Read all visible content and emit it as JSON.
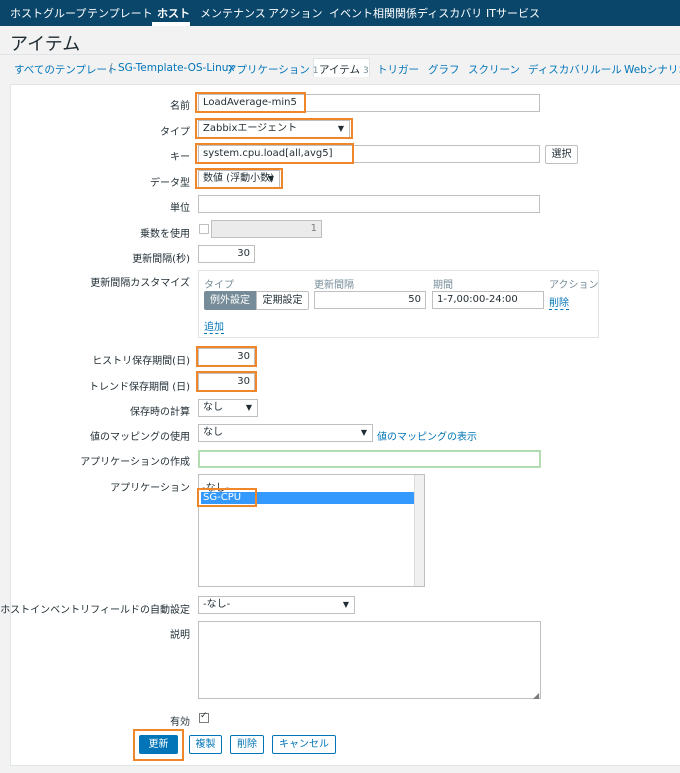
{
  "nav": {
    "items": [
      "ホストグループ",
      "テンプレート",
      "ホスト",
      "メンテナンス",
      "アクション",
      "イベント相関関係",
      "ディスカバリ",
      "ITサービス"
    ],
    "active_index": 2
  },
  "page": {
    "title": "アイテム"
  },
  "breadcrumb": {
    "all_templates": "すべてのテンプレート",
    "separator": "/",
    "template": "SG-Template-OS-Linux",
    "tabs": [
      {
        "label": "アプリケーション",
        "count": "1"
      },
      {
        "label": "アイテム",
        "count": "3"
      },
      {
        "label": "トリガー",
        "count": ""
      },
      {
        "label": "グラフ",
        "count": ""
      },
      {
        "label": "スクリーン",
        "count": ""
      },
      {
        "label": "ディスカバリルール",
        "count": ""
      },
      {
        "label": "Webシナリオ",
        "count": ""
      }
    ]
  },
  "form": {
    "name_label": "名前",
    "name_value": "LoadAverage-min5",
    "type_label": "タイプ",
    "type_value": "Zabbixエージェント",
    "key_label": "キー",
    "key_value": "system.cpu.load[all,avg5]",
    "key_select_button": "選択",
    "datatype_label": "データ型",
    "datatype_value": "数値 (浮動小数)",
    "unit_label": "単位",
    "unit_value": "",
    "multiplier_label": "乗数を使用",
    "multiplier_value": "1",
    "interval_label": "更新間隔(秒)",
    "interval_value": "30",
    "custom_label": "更新間隔カスタマイズ",
    "custom": {
      "col_type": "タイプ",
      "col_interval": "更新間隔",
      "col_period": "期間",
      "col_action": "アクション",
      "type_flexible": "例外設定",
      "type_scheduling": "定期設定",
      "interval_value": "50",
      "period_value": "1-7,00:00-24:00",
      "remove": "削除",
      "add": "追加"
    },
    "history_label": "ヒストリ保存期間(日)",
    "history_value": "30",
    "trends_label": "トレンド保存期間 (日)",
    "trends_value": "30",
    "store_label": "保存時の計算",
    "store_value": "なし",
    "valuemap_label": "値のマッピングの使用",
    "valuemap_value": "なし",
    "valuemap_link": "値のマッピングの表示",
    "newapp_label": "アプリケーションの作成",
    "newapp_value": "",
    "apps_label": "アプリケーション",
    "apps_options": [
      "-なし-",
      "SG-CPU"
    ],
    "inventory_label": "ホストインベントリフィールドの自動設定",
    "inventory_value": "-なし-",
    "desc_label": "説明",
    "desc_value": "",
    "enabled_label": "有効"
  },
  "buttons": {
    "update": "更新",
    "clone": "複製",
    "delete": "削除",
    "cancel": "キャンセル"
  },
  "colors": {
    "nav_bg": "#0a466a",
    "accent": "#0275b8",
    "highlight": "#f0862a",
    "selected": "#3399ff"
  }
}
